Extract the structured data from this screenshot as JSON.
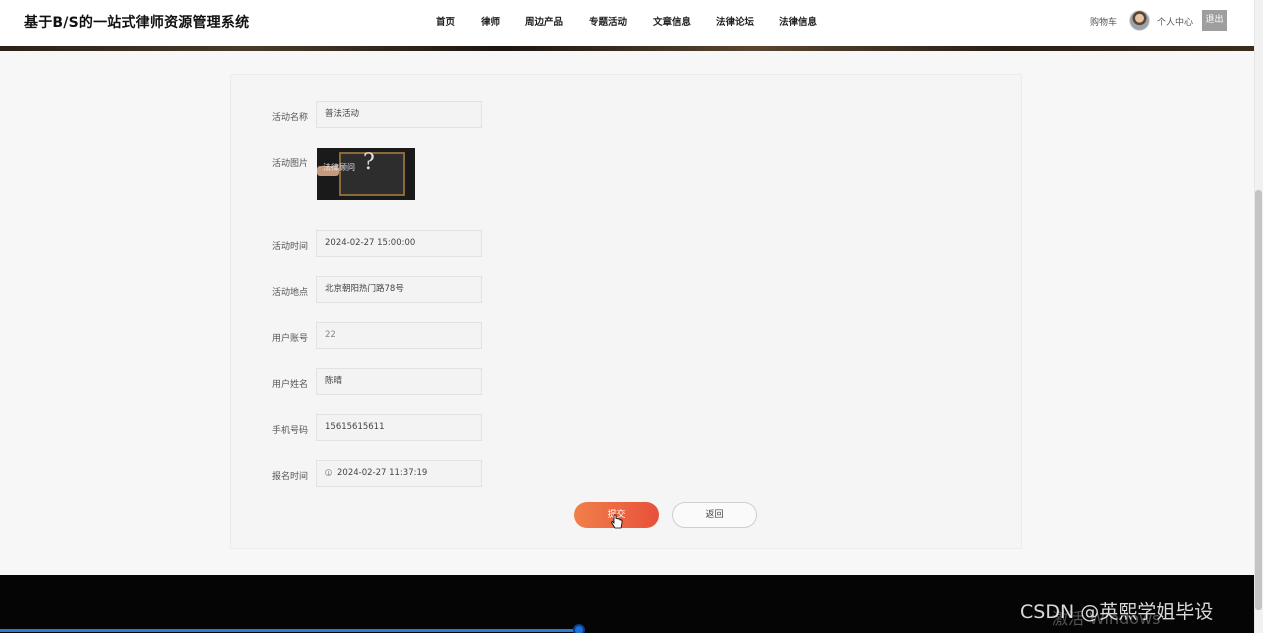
{
  "header": {
    "site_title": "基于B/S的一站式律师资源管理系统",
    "nav": [
      "首页",
      "律师",
      "周边产品",
      "专题活动",
      "文章信息",
      "法律论坛",
      "法律信息"
    ],
    "cart_label": "购物车",
    "profile_label": "个人中心",
    "logout_label": "退出"
  },
  "form": {
    "activity_name_label": "活动名称",
    "activity_name_value": "普法活动",
    "activity_image_label": "活动图片",
    "activity_image_text": "法律顾问",
    "activity_time_label": "活动时间",
    "activity_time_value": "2024-02-27 15:00:00",
    "activity_location_label": "活动地点",
    "activity_location_value": "北京朝阳热门路78号",
    "user_account_label": "用户账号",
    "user_account_value": "22",
    "user_name_label": "用户姓名",
    "user_name_value": "陈晴",
    "phone_label": "手机号码",
    "phone_value": "15615615611",
    "signup_time_label": "报名时间",
    "signup_time_value": "2024-02-27 11:37:19",
    "submit_label": "提交",
    "back_label": "返回"
  },
  "footer": {
    "watermark": "CSDN @英熙学姐毕设",
    "watermark_ghost": "激活 Windows"
  },
  "icons": {
    "clock": "clock-icon",
    "cursor": "hand-cursor-icon"
  },
  "colors": {
    "submit_start": "#f0804a",
    "submit_end": "#e8503a",
    "footer": "#050505"
  }
}
